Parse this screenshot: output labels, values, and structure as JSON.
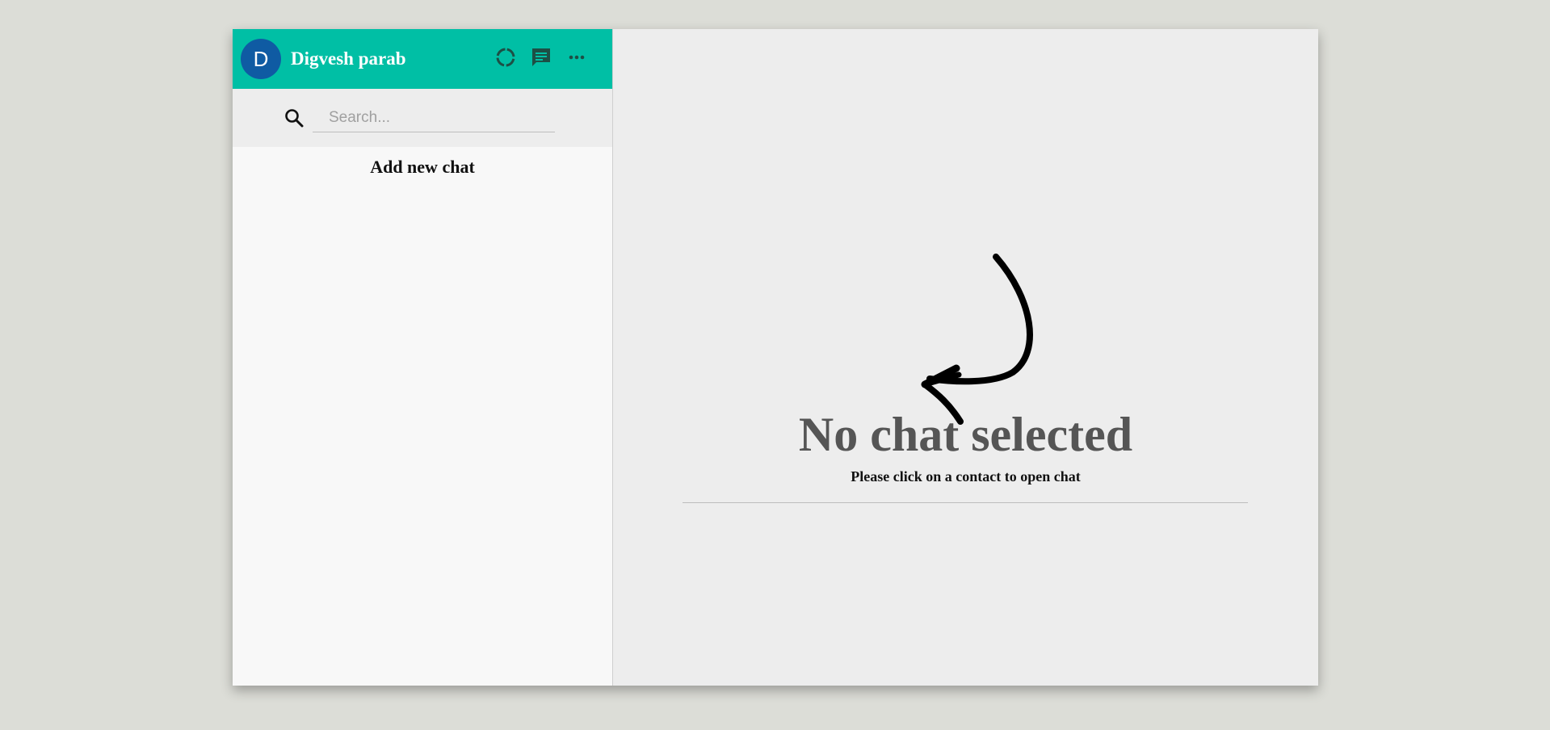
{
  "user": {
    "avatar_letter": "D",
    "name": "Digvesh parab"
  },
  "header_icons": [
    {
      "name": "status-icon"
    },
    {
      "name": "chat-icon"
    },
    {
      "name": "more-icon"
    }
  ],
  "search": {
    "placeholder": "Search..."
  },
  "sidebar": {
    "add_new_chat": "Add new chat"
  },
  "main": {
    "title": "No chat selected",
    "subtitle": "Please click on a contact to open chat"
  },
  "colors": {
    "header": "#00bfa5",
    "avatar": "#0f5ba3",
    "background": "#dcddd7"
  }
}
